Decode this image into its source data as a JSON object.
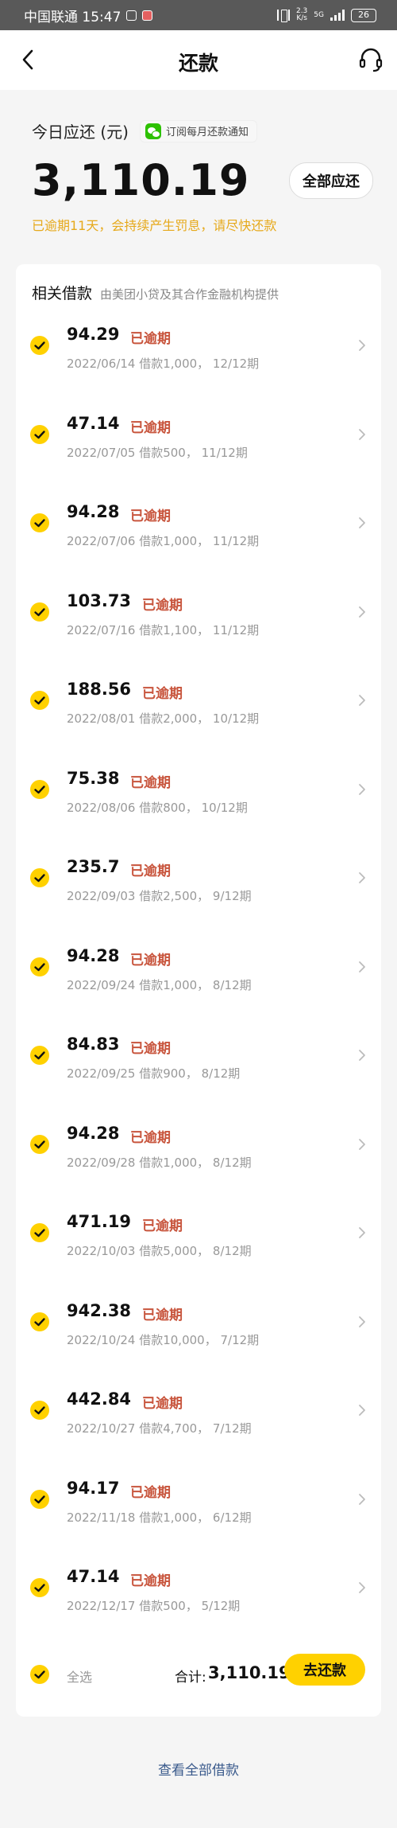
{
  "status_bar": {
    "carrier_time": "中国联通 15:47",
    "speed_top": "2.3",
    "speed_bottom": "K/s",
    "network": "5G",
    "battery": "26"
  },
  "nav": {
    "title": "还款"
  },
  "summary": {
    "due_label": "今日应还 (元)",
    "notify_chip": "订阅每月还款通知",
    "amount": "3,110.19",
    "pay_all_label": "全部应还",
    "warning": "已逾期11天，会持续产生罚息，请尽快还款"
  },
  "loans_card": {
    "title": "相关借款",
    "subtitle": "由美团小贷及其合作金融机构提供",
    "overdue_label": "已逾期",
    "items": [
      {
        "amount": "94.29",
        "detail": "2022/06/14 借款1,000， 12/12期"
      },
      {
        "amount": "47.14",
        "detail": "2022/07/05 借款500， 11/12期"
      },
      {
        "amount": "94.28",
        "detail": "2022/07/06 借款1,000， 11/12期"
      },
      {
        "amount": "103.73",
        "detail": "2022/07/16 借款1,100， 11/12期"
      },
      {
        "amount": "188.56",
        "detail": "2022/08/01 借款2,000， 10/12期"
      },
      {
        "amount": "75.38",
        "detail": "2022/08/06 借款800， 10/12期"
      },
      {
        "amount": "235.7",
        "detail": "2022/09/03 借款2,500， 9/12期"
      },
      {
        "amount": "94.28",
        "detail": "2022/09/24 借款1,000， 8/12期"
      },
      {
        "amount": "84.83",
        "detail": "2022/09/25 借款900， 8/12期"
      },
      {
        "amount": "94.28",
        "detail": "2022/09/28 借款1,000， 8/12期"
      },
      {
        "amount": "471.19",
        "detail": "2022/10/03 借款5,000， 8/12期"
      },
      {
        "amount": "942.38",
        "detail": "2022/10/24 借款10,000， 7/12期"
      },
      {
        "amount": "442.84",
        "detail": "2022/10/27 借款4,700， 7/12期"
      },
      {
        "amount": "94.17",
        "detail": "2022/11/18 借款1,000， 6/12期"
      },
      {
        "amount": "47.14",
        "detail": "2022/12/17 借款500， 5/12期"
      }
    ],
    "footer": {
      "select_all": "全选",
      "total_label": "合计:",
      "total_amount": "3,110.19",
      "pay_button": "去还款"
    }
  },
  "view_all": "查看全部借款",
  "colors": {
    "accent_yellow": "#ffd100",
    "overdue_red": "#c8553d",
    "warning_orange": "#e6a91b",
    "link_blue": "#3a5a8c"
  }
}
